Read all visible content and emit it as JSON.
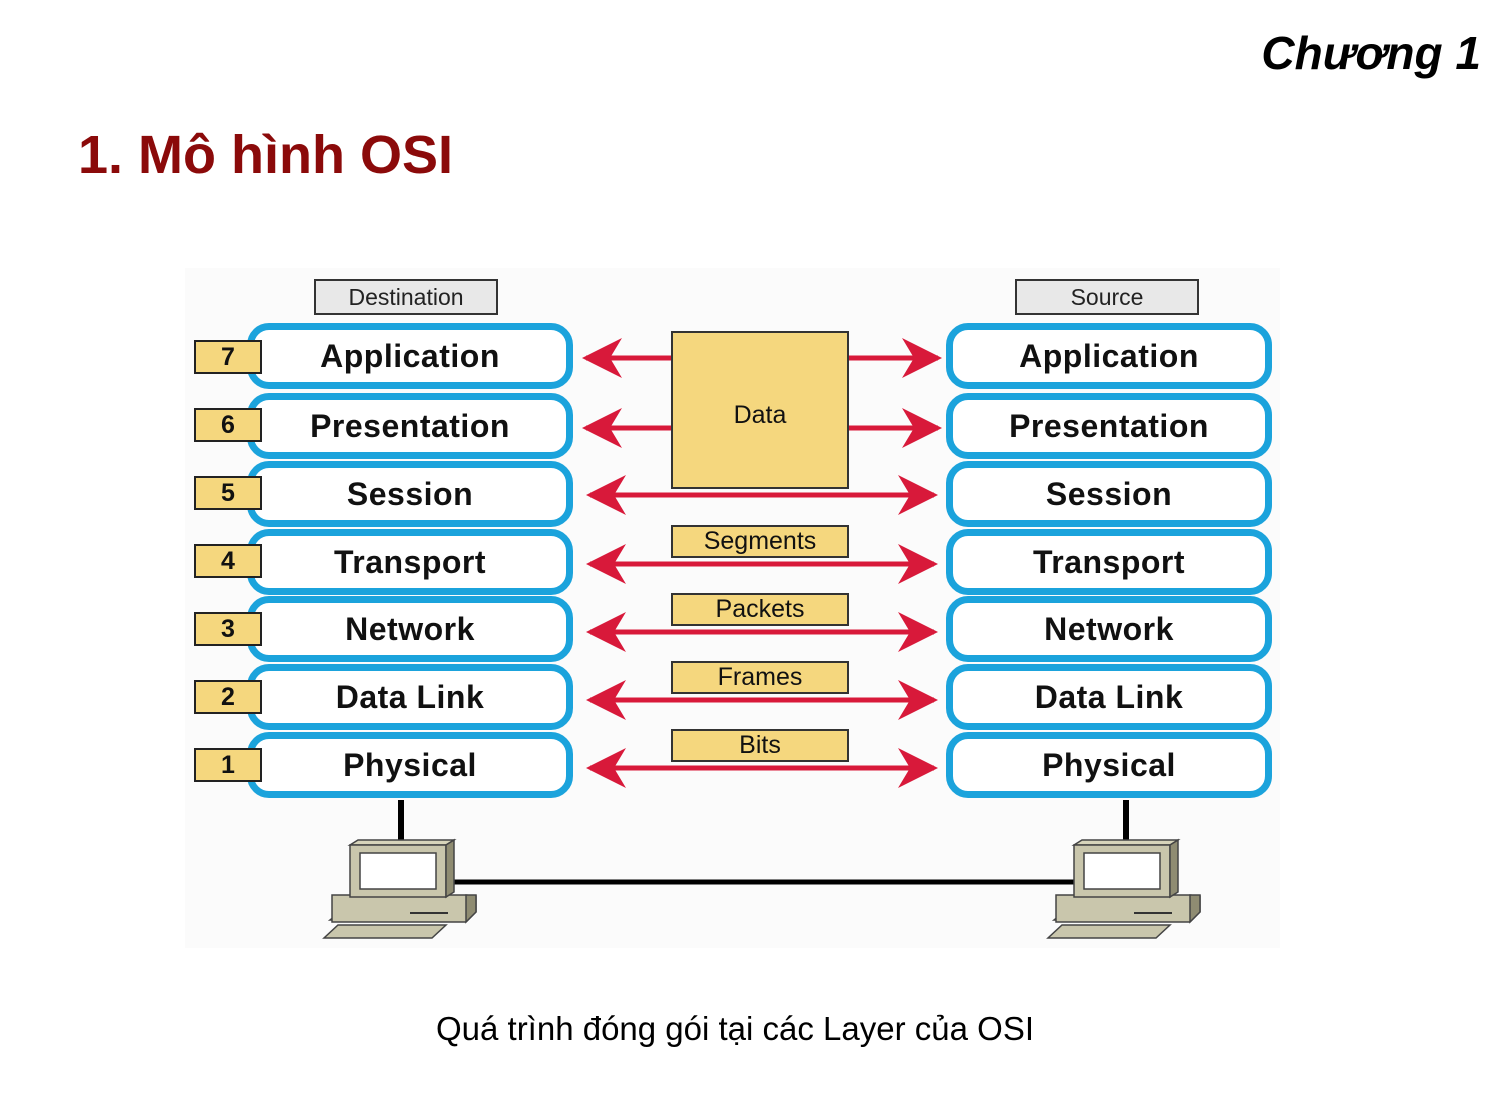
{
  "header": {
    "chapter": "Chương 1"
  },
  "slide": {
    "title": "1. Mô hình OSI",
    "caption": "Quá trình đóng gói tại các Layer của OSI"
  },
  "diagram": {
    "destination_label": "Destination",
    "source_label": "Source",
    "layers": [
      {
        "number": "7",
        "name": "Application"
      },
      {
        "number": "6",
        "name": "Presentation"
      },
      {
        "number": "5",
        "name": "Session"
      },
      {
        "number": "4",
        "name": "Transport"
      },
      {
        "number": "3",
        "name": "Network"
      },
      {
        "number": "2",
        "name": "Data Link"
      },
      {
        "number": "1",
        "name": "Physical"
      }
    ],
    "pdus": {
      "data": "Data",
      "segments": "Segments",
      "packets": "Packets",
      "frames": "Frames",
      "bits": "Bits"
    },
    "colors": {
      "layer_border": "#1ba3dc",
      "pdu_fill": "#f5d77e",
      "arrow": "#d8193a",
      "title": "#8b0a0a",
      "computer": "#c9c6ac"
    }
  }
}
